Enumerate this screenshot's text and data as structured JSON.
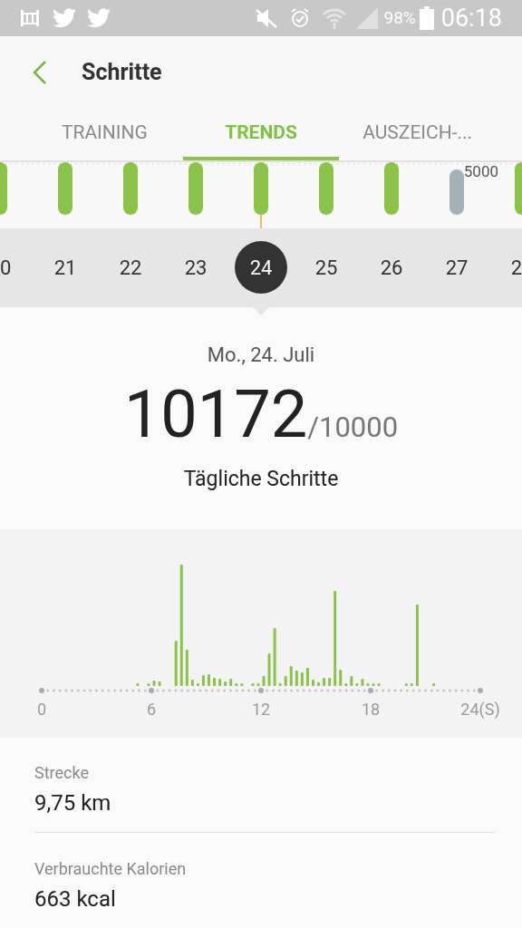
{
  "status_bar": {
    "battery": "98%",
    "time": "06:18"
  },
  "header": {
    "title": "Schritte"
  },
  "tabs": [
    {
      "label": "TRAINING",
      "selected": false
    },
    {
      "label": "TRENDS",
      "selected": true
    },
    {
      "label": "AUSZEICH-...",
      "selected": false
    }
  ],
  "trend_chart": {
    "goal_label": "5000",
    "bars": [
      {
        "goal_met": true
      },
      {
        "goal_met": true
      },
      {
        "goal_met": true
      },
      {
        "goal_met": true
      },
      {
        "goal_met": true
      },
      {
        "goal_met": true
      },
      {
        "goal_met": true
      },
      {
        "goal_met": false
      },
      {
        "goal_met": true
      }
    ]
  },
  "days": [
    {
      "label": "0",
      "selected": false
    },
    {
      "label": "21",
      "selected": false
    },
    {
      "label": "22",
      "selected": false
    },
    {
      "label": "23",
      "selected": false
    },
    {
      "label": "24",
      "selected": true
    },
    {
      "label": "25",
      "selected": false
    },
    {
      "label": "26",
      "selected": false
    },
    {
      "label": "27",
      "selected": false
    },
    {
      "label": "2",
      "selected": false
    }
  ],
  "summary": {
    "date": "Mo., 24. Juli",
    "steps": "10172",
    "goal": "/10000",
    "caption": "Tägliche Schritte"
  },
  "hourly_chart": {
    "ticks": [
      "0",
      "6",
      "12",
      "18",
      "24(S)"
    ]
  },
  "stats": [
    {
      "label": "Strecke",
      "value": "9,75 km"
    },
    {
      "label": "Verbrauchte Kalorien",
      "value": "663 kcal"
    }
  ]
}
